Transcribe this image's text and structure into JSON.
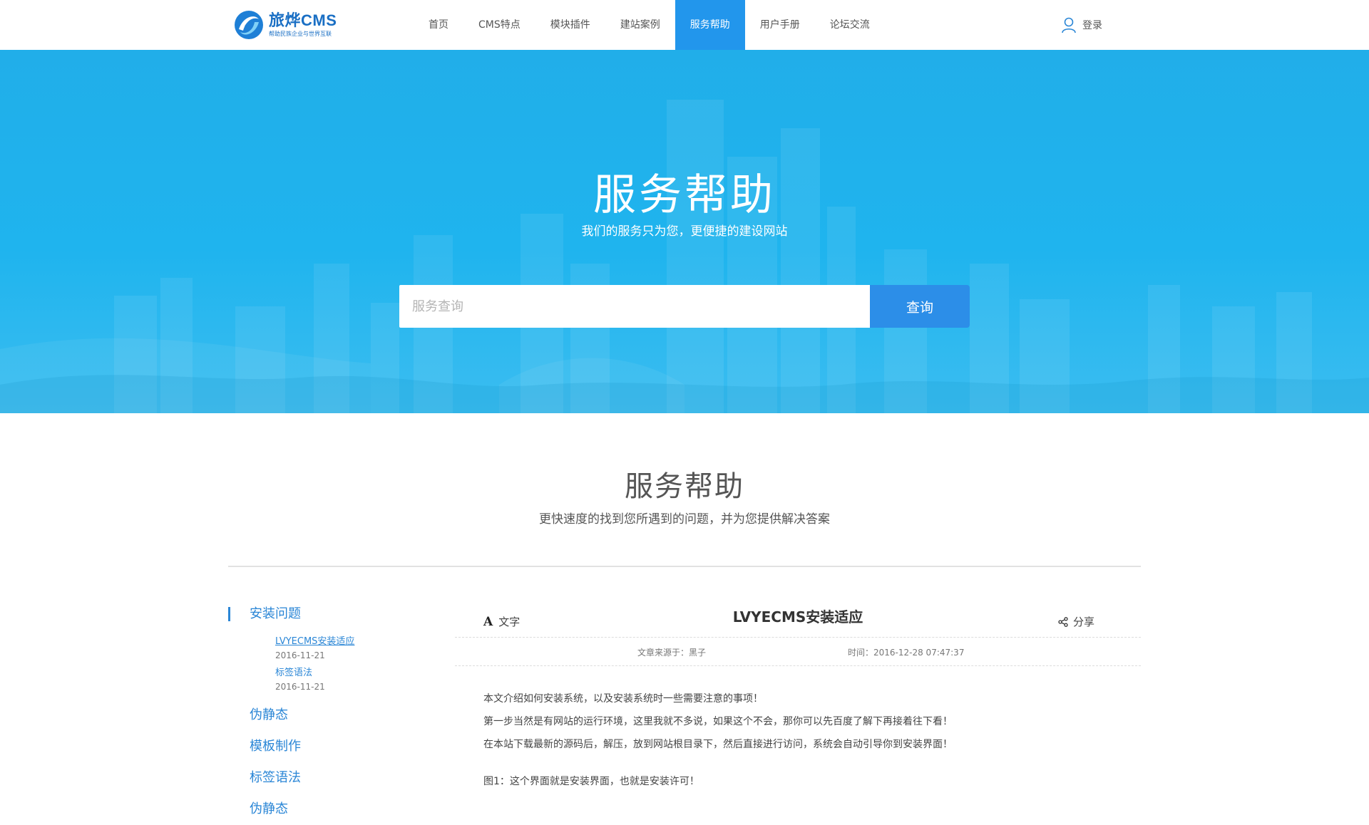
{
  "header": {
    "logo_name": "旅烨CMS",
    "logo_slogan": "帮助民族企业与世界互联",
    "nav": [
      {
        "label": "首页",
        "active": false
      },
      {
        "label": "CMS特点",
        "active": false
      },
      {
        "label": "模块插件",
        "active": false
      },
      {
        "label": "建站案例",
        "active": false
      },
      {
        "label": "服务帮助",
        "active": true
      },
      {
        "label": "用户手册",
        "active": false
      },
      {
        "label": "论坛交流",
        "active": false
      }
    ],
    "login_label": "登录",
    "login_icon": "user-icon"
  },
  "hero": {
    "title": "服务帮助",
    "subtitle": "我们的服务只为您，更便捷的建设网站",
    "search_placeholder": "服务查询",
    "search_value": "",
    "search_button": "查询"
  },
  "section": {
    "title": "服务帮助",
    "subtitle": "更快速度的找到您所遇到的问题，并为您提供解决答案"
  },
  "sidebar": {
    "active_category": "安装问题",
    "sub_items": [
      {
        "title": "LVYECMS安装适应",
        "date": "2016-11-21"
      },
      {
        "title": "标签语法",
        "date": "2016-11-21"
      }
    ],
    "other_categories": [
      "伪静态",
      "模板制作",
      "标签语法",
      "伪静态"
    ]
  },
  "article": {
    "font_tool_glyph": "A",
    "font_tool_label": "文字",
    "title": "LVYECMS安装适应",
    "share_label": "分享",
    "share_icon": "share-icon",
    "source": "文章来源于：黑子",
    "time": "时间：2016-12-28 07:47:37",
    "paragraphs": [
      "本文介绍如何安装系统，以及安装系统时一些需要注意的事项！",
      "第一步当然是有网站的运行环境，这里我就不多说，如果这个不会，那你可以先百度了解下再接着往下看！",
      "在本站下载最新的源码后，解压，放到网站根目录下，然后直接进行访问，系统会自动引导你到安装界面！",
      "图1：这个界面就是安装界面，也就是安装许可！"
    ]
  },
  "colors": {
    "accent": "#2296ec",
    "hero_bg": "#1fb4ee",
    "link": "#2a86d6"
  }
}
